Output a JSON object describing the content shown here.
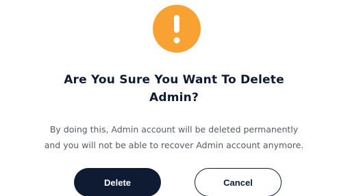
{
  "dialog": {
    "icon": "exclamation-warning-icon",
    "icon_color": "#F7A233",
    "title_line1": "Are You Sure You Want To Delete",
    "title_line2": "Admin?",
    "message_line1": "By doing this, Admin account will be deleted permanently",
    "message_line2": "and you will not be able to recover Admin account anymore.",
    "delete_label": "Delete",
    "cancel_label": "Cancel",
    "primary_color": "#0E1B33"
  }
}
